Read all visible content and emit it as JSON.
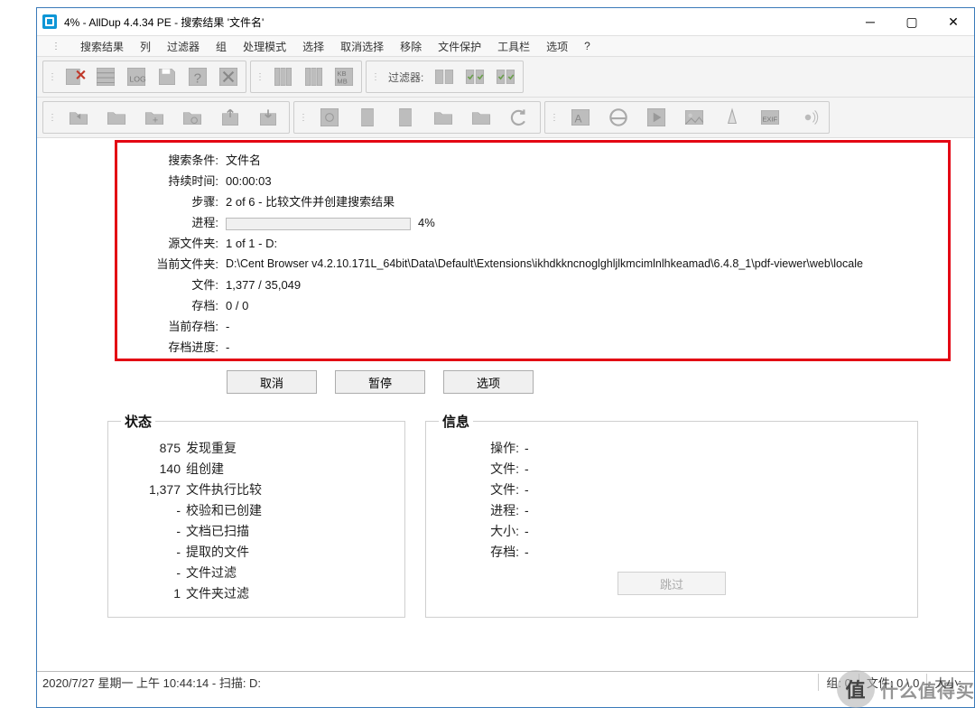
{
  "window": {
    "title": "4% - AllDup 4.4.34 PE - 搜索结果 '文件名'"
  },
  "menu": [
    "搜索结果",
    "列",
    "过滤器",
    "组",
    "处理模式",
    "选择",
    "取消选择",
    "移除",
    "文件保护",
    "工具栏",
    "选项",
    "?"
  ],
  "toolbar2": {
    "filter_label": "过滤器:"
  },
  "progress": {
    "rows": {
      "search_condition": {
        "label": "搜索条件:",
        "value": "文件名"
      },
      "duration": {
        "label": "持续时间:",
        "value": "00:00:03"
      },
      "step": {
        "label": "步骤:",
        "value": "2 of 6 - 比较文件并创建搜索结果"
      },
      "proc": {
        "label": "进程:",
        "percent": "4%"
      },
      "src_folder": {
        "label": "源文件夹:",
        "value": "1 of 1 - D:"
      },
      "cur_folder": {
        "label": "当前文件夹:",
        "value": "D:\\Cent Browser v4.2.10.171L_64bit\\Data\\Default\\Extensions\\ikhdkkncnoglghljlkmcimlnlhkeamad\\6.4.8_1\\pdf-viewer\\web\\locale"
      },
      "files": {
        "label": "文件:",
        "value": "1,377 / 35,049"
      },
      "archive": {
        "label": "存档:",
        "value": "0 / 0"
      },
      "cur_archive": {
        "label": "当前存档:",
        "value": "-"
      },
      "arch_prog": {
        "label": "存档进度:",
        "value": "-"
      }
    }
  },
  "buttons": {
    "cancel": "取消",
    "pause": "暂停",
    "options": "选项",
    "skip": "跳过"
  },
  "status_box": {
    "legend": "状态",
    "items": [
      {
        "n": "875",
        "t": "发现重复"
      },
      {
        "n": "140",
        "t": "组创建"
      },
      {
        "n": "1,377",
        "t": "文件执行比较"
      },
      {
        "n": "-",
        "t": "校验和已创建"
      },
      {
        "n": "-",
        "t": "文档已扫描"
      },
      {
        "n": "-",
        "t": "提取的文件"
      },
      {
        "n": "-",
        "t": "文件过滤"
      },
      {
        "n": "1",
        "t": "文件夹过滤"
      }
    ]
  },
  "info_box": {
    "legend": "信息",
    "items": [
      {
        "n": "操作:",
        "t": "-"
      },
      {
        "n": "文件:",
        "t": "-"
      },
      {
        "n": "文件:",
        "t": "-"
      },
      {
        "n": "进程:",
        "t": "-"
      },
      {
        "n": "大小:",
        "t": "-"
      },
      {
        "n": "存档:",
        "t": "-"
      }
    ]
  },
  "statusbar": {
    "left": "2020/7/27 星期一 上午 10:44:14 - 扫描: D:",
    "cells": {
      "group": "组: 0",
      "files": "文件: 0 \\ 0",
      "size": "大小:"
    }
  },
  "watermark": "什么值得买"
}
